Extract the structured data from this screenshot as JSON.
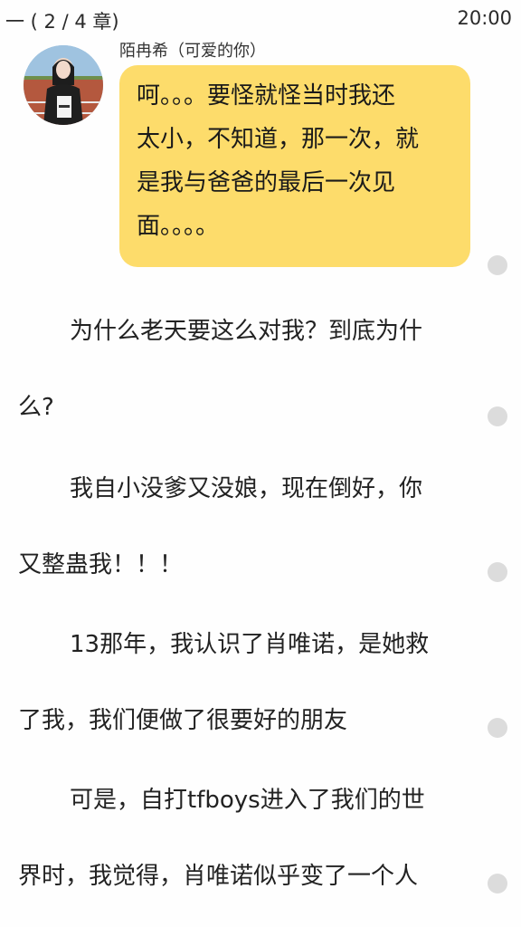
{
  "status": {
    "chapter_progress": "一 ( 2 / 4 章)",
    "time": "20:00"
  },
  "message": {
    "sender_name": "陌冉希（可爱的你）",
    "avatar_icon": "user-avatar-photo",
    "text_lines": [
      "呵。。。要怪就怪当时我还",
      "太小，不知道，那一次，就",
      "是我与爸爸的最后一次见",
      "面。。。。"
    ],
    "bubble_color": "#fddc6b"
  },
  "paragraphs": [
    {
      "lines": [
        "为什么老天要这么对我？到底为什",
        "么?"
      ]
    },
    {
      "lines": [
        "我自小没爹又没娘，现在倒好，你",
        "又整蛊我！！！"
      ]
    },
    {
      "lines": [
        "13那年，我认识了肖唯诺，是她救",
        "了我，我们便做了很要好的朋友"
      ]
    },
    {
      "lines": [
        "可是，自打tfboys进入了我们的世",
        "界时，我觉得，肖唯诺似乎变了一个人"
      ]
    }
  ]
}
